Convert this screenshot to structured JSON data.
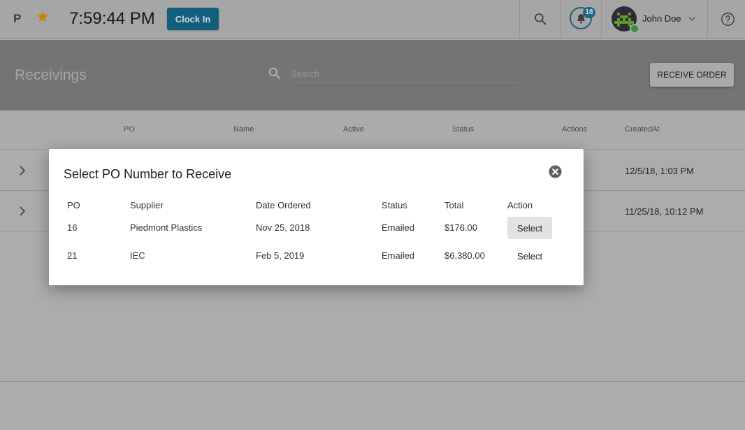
{
  "topbar": {
    "logo": "P",
    "time": "7:59:44 PM",
    "clock_in_label": "Clock In",
    "notification_count": "18",
    "user_name": "John Doe",
    "icons": [
      "star-icon",
      "search-icon",
      "bell-icon",
      "avatar",
      "chevron-down-icon",
      "help-icon"
    ]
  },
  "page": {
    "title": "Receivings",
    "search_placeholder": "Search",
    "receive_order_label": "RECEIVE ORDER"
  },
  "table": {
    "columns": [
      "PO",
      "Name",
      "Active",
      "Status",
      "Actions",
      "CreatedAt"
    ],
    "rows": [
      {
        "created_at": "12/5/18, 1:03 PM"
      },
      {
        "created_at": "11/25/18, 10:12 PM"
      }
    ]
  },
  "modal": {
    "title": "Select PO Number to Receive",
    "columns": {
      "po": "PO",
      "supplier": "Supplier",
      "date": "Date Ordered",
      "status": "Status",
      "total": "Total",
      "action": "Action"
    },
    "rows": [
      {
        "po": "16",
        "supplier": "Piedmont Plastics",
        "date": "Nov 25, 2018",
        "status": "Emailed",
        "total": "$176.00",
        "action": "Select"
      },
      {
        "po": "21",
        "supplier": "IEC",
        "date": "Feb 5, 2019",
        "status": "Emailed",
        "total": "$6,380.00",
        "action": "Select"
      }
    ]
  },
  "colors": {
    "accent": "#135e7d",
    "star": "#c8860a",
    "overlay_bg": "#acacac",
    "modal_bg": "#ffffff"
  }
}
